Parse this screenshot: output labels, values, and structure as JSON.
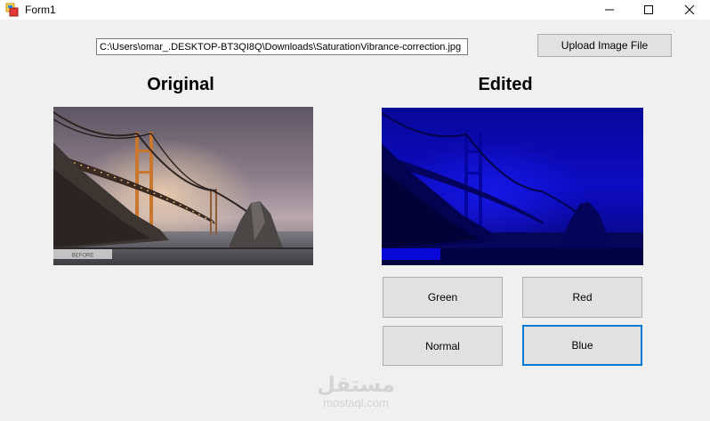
{
  "window": {
    "title": "Form1",
    "icon": "winforms-app-icon"
  },
  "toolbar": {
    "path_value": "C:\\Users\\omar_.DESKTOP-BT3QI8Q\\Downloads\\SaturationVibrance-correction.jpg",
    "upload_label": "Upload Image File"
  },
  "panels": {
    "original_heading": "Original",
    "edited_heading": "Edited"
  },
  "images": {
    "original_label": "BEFORE"
  },
  "filters": {
    "green_label": "Green",
    "red_label": "Red",
    "normal_label": "Normal",
    "blue_label": "Blue",
    "focused": "Blue"
  },
  "colors": {
    "accent": "#0078d7",
    "button_bg": "#e1e1e1",
    "window_bg": "#f0f0f0"
  },
  "watermark": {
    "arabic": "مستقل",
    "latin": "mostaql.com"
  }
}
